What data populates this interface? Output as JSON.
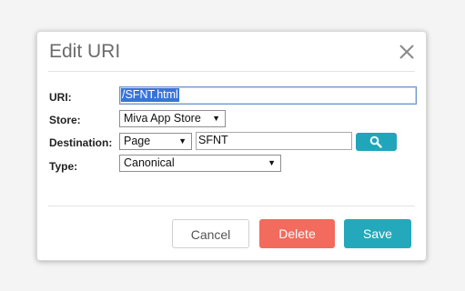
{
  "dialog": {
    "title": "Edit URI",
    "close_icon": "close-icon"
  },
  "form": {
    "uri": {
      "label": "URI:",
      "value": "/SFNT.html"
    },
    "store": {
      "label": "Store:",
      "value": "Miva App Store"
    },
    "destination": {
      "label": "Destination:",
      "type_value": "Page",
      "target_value": "SFNT",
      "search_icon": "magnifier-icon"
    },
    "type": {
      "label": "Type:",
      "value": "Canonical"
    }
  },
  "buttons": {
    "cancel": "Cancel",
    "delete": "Delete",
    "save": "Save"
  },
  "colors": {
    "delete": "#f26b5d",
    "save": "#23a9bb",
    "search": "#20a6ba",
    "selection": "#3874d8"
  }
}
